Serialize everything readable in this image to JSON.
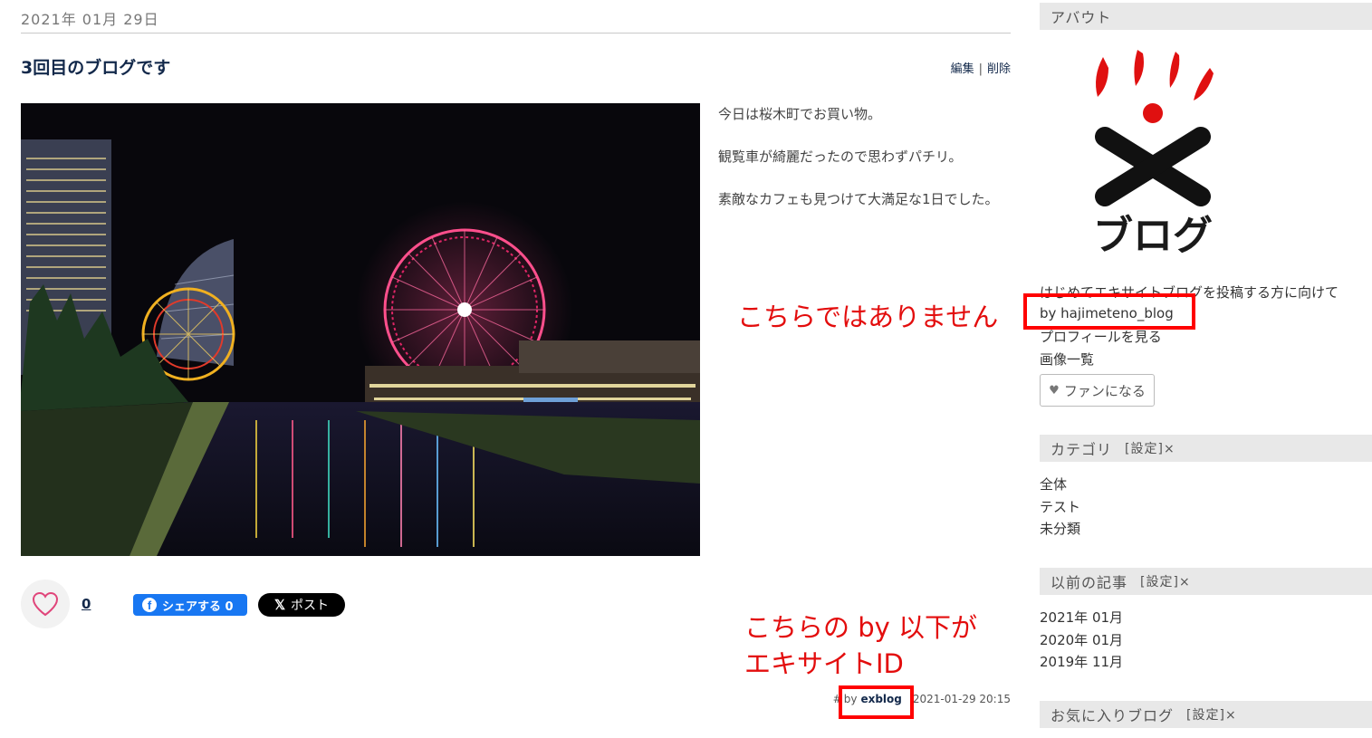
{
  "post": {
    "date": "2021年 01月 29日",
    "title": "3回目のブログです",
    "edit_label": "編集",
    "delete_label": "削除",
    "paragraphs": [
      "今日は桜木町でお買い物。",
      "観覧車が綺麗だったので思わずパチリ。",
      "素敵なカフェも見つけて大満足な1日でした。"
    ],
    "like_count": "0",
    "fb_share_label": "シェアする 0",
    "x_post_label": "ポスト",
    "footer": {
      "hash": "#",
      "by": "by",
      "author": "exblog",
      "timestamp": "2021-01-29 20:15"
    }
  },
  "annotations": {
    "note1": "こちらではありません",
    "note2_line1": "こちらの by 以下が",
    "note2_line2": "エキサイトID",
    "color": "#e30d0d"
  },
  "sidebar": {
    "about_heading": "アバウト",
    "logo_text": "ブログ",
    "description": "はじめてエキサイトブログを投稿する方に向けて",
    "by_line": "by hajimeteno_blog",
    "profile_link": "プロフィールを見る",
    "images_link": "画像一覧",
    "fan_button": "ファンになる",
    "category_heading": "カテゴリ",
    "category_config": "[設定]×",
    "categories": [
      "全体",
      "テスト",
      "未分類"
    ],
    "archive_heading": "以前の記事",
    "archive_config": "[設定]×",
    "archives": [
      "2021年 01月",
      "2020年 01月",
      "2019年 11月"
    ],
    "favorites_heading": "お気に入りブログ",
    "favorites_config": "[設定]×"
  },
  "colors": {
    "accent_navy": "#13294b",
    "facebook": "#1877f2",
    "highlight_red": "#ff0000",
    "logo_red": "#e01010"
  }
}
